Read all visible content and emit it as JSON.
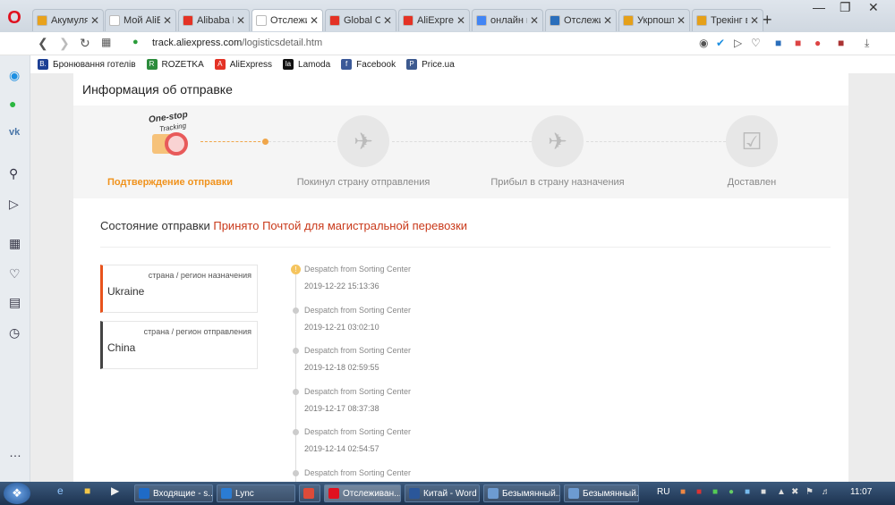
{
  "browser": {
    "tabs": [
      {
        "label": "Акумулятор",
        "icon": "gift-icon",
        "color": "#e8a21c"
      },
      {
        "label": "Мой AliExpress",
        "icon": "page-icon",
        "color": "#ffffff"
      },
      {
        "label": "Alibaba Ma",
        "icon": "alibaba-icon",
        "color": "#e43225"
      },
      {
        "label": "Отслежива",
        "icon": "page-icon",
        "color": "#ffffff"
      },
      {
        "label": "Global Ord",
        "icon": "alibaba-icon",
        "color": "#e43225"
      },
      {
        "label": "AliExpress",
        "icon": "aliexpress-icon",
        "color": "#e43225"
      },
      {
        "label": "онлайн пе",
        "icon": "google-icon",
        "color": "#4285f4"
      },
      {
        "label": "Отслежив",
        "icon": "track-icon",
        "color": "#2a6ebb"
      },
      {
        "label": "Укрпошта",
        "icon": "pin-icon",
        "color": "#e5a019"
      },
      {
        "label": "Трекінг ві",
        "icon": "pin-icon",
        "color": "#e5a019"
      }
    ],
    "url_host": "track.aliexpress.com",
    "url_path": "/logisticsdetail.htm",
    "bookmarks": [
      {
        "label": "Бронювання готелів",
        "icon": "B.",
        "color": "#1c3f94"
      },
      {
        "label": "ROZETKA",
        "icon": "R",
        "color": "#2c8c3c"
      },
      {
        "label": "AliExpress",
        "icon": "A",
        "color": "#e43225"
      },
      {
        "label": "Lamoda",
        "icon": "la",
        "color": "#111111"
      },
      {
        "label": "Facebook",
        "icon": "f",
        "color": "#3b5998"
      },
      {
        "label": "Price.ua",
        "icon": "P",
        "color": "#3d5a8f"
      }
    ]
  },
  "page": {
    "title": "Информация об отправке",
    "logo_top": "One-stop",
    "logo_bottom": "Tracking",
    "steps": [
      {
        "label": "Подтверждение отправки",
        "active": true
      },
      {
        "label": "Покинул страну отправления",
        "active": false
      },
      {
        "label": "Прибыл в страну назначения",
        "active": false
      },
      {
        "label": "Доставлен",
        "active": false
      }
    ],
    "status_label": "Состояние отправки",
    "status_value": "Принято Почтой для магистральной перевозки",
    "destination": {
      "caption": "страна / регион назначения",
      "value": "Ukraine",
      "accent": "#e8531c"
    },
    "origin": {
      "caption": "страна / регион отправления",
      "value": "China",
      "accent": "#444444"
    },
    "events": [
      {
        "desc": "Despatch from Sorting Center",
        "time": "2019-12-22 15:13:36"
      },
      {
        "desc": "Despatch from Sorting Center",
        "time": "2019-12-21 03:02:10"
      },
      {
        "desc": "Despatch from Sorting Center",
        "time": "2019-12-18 02:59:55"
      },
      {
        "desc": "Despatch from Sorting Center",
        "time": "2019-12-17 08:37:38"
      },
      {
        "desc": "Despatch from Sorting Center",
        "time": "2019-12-14 02:54:57"
      },
      {
        "desc": "Despatch from Sorting Center",
        "time": ""
      }
    ]
  },
  "taskbar": {
    "items": [
      {
        "label": "Входящие - s...",
        "icon": "outlook-icon",
        "color": "#1f6bc7"
      },
      {
        "label": "Lync",
        "icon": "lync-icon",
        "color": "#2b7cd3"
      },
      {
        "label": "",
        "icon": "chrome-icon",
        "color": "#dd4b39"
      },
      {
        "label": "Отслеживан...",
        "icon": "opera-icon",
        "color": "#e0111f"
      },
      {
        "label": "Китай - Word",
        "icon": "word-icon",
        "color": "#2b579a"
      },
      {
        "label": "Безымянный...",
        "icon": "paint-icon",
        "color": "#6d9bd1"
      },
      {
        "label": "Безымянный...",
        "icon": "paint-icon",
        "color": "#6d9bd1"
      }
    ],
    "lang": "RU",
    "clock": "11:07"
  }
}
